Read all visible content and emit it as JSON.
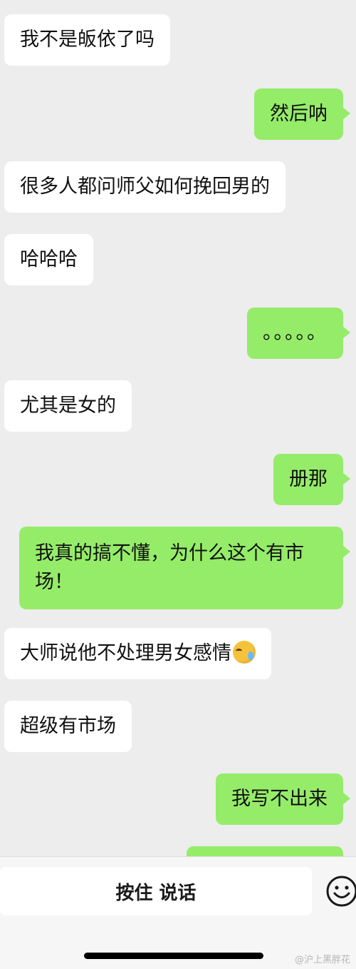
{
  "messages": [
    {
      "side": "in",
      "text": "我不是皈依了吗"
    },
    {
      "side": "out",
      "text": "然后呐"
    },
    {
      "side": "in",
      "text": "很多人都问师父如何挽回男的"
    },
    {
      "side": "in",
      "text": "哈哈哈"
    },
    {
      "side": "out",
      "text": "。。。。。"
    },
    {
      "side": "in",
      "text": "尤其是女的"
    },
    {
      "side": "out",
      "text": "册那"
    },
    {
      "side": "out",
      "text": "我真的搞不懂，为什么这个有市场！"
    },
    {
      "side": "in",
      "text": "大师说他不处理男女感情",
      "emoji": "face-with-tears-icon"
    },
    {
      "side": "in",
      "text": "超级有市场"
    },
    {
      "side": "out",
      "text": "我写不出来"
    },
    {
      "side": "out",
      "text": ""
    }
  ],
  "input_bar": {
    "voice_button_label": "按住 说话",
    "emoji_button_icon": "smiley-face-icon"
  },
  "watermark": "@沪上黑胖花",
  "colors": {
    "background": "#ededed",
    "incoming_bubble": "#ffffff",
    "outgoing_bubble": "#95ec69"
  }
}
